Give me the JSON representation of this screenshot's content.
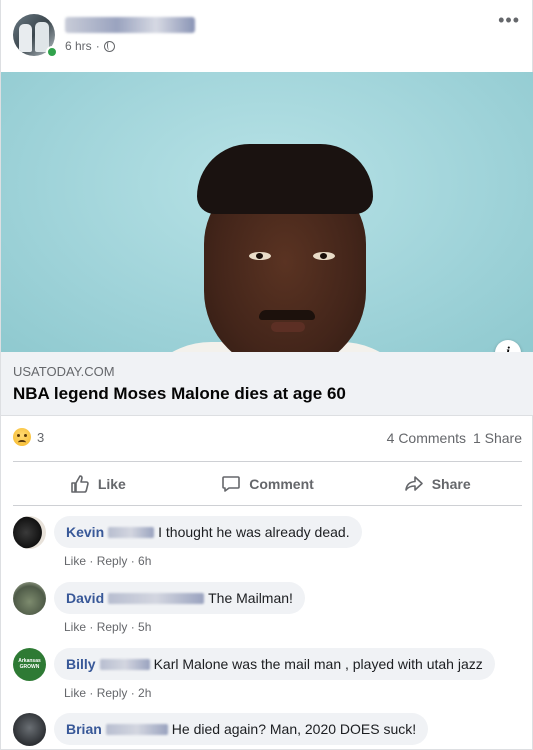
{
  "post": {
    "time": "6 hrs",
    "separator": "·",
    "more_label": "•••"
  },
  "link": {
    "domain": "USATODAY.COM",
    "title": "NBA legend Moses Malone dies at age 60",
    "info_label": "i"
  },
  "reactions": {
    "count": "3",
    "comments": "4 Comments",
    "shares": "1 Share"
  },
  "actions": {
    "like": "Like",
    "comment": "Comment",
    "share": "Share"
  },
  "comments": [
    {
      "name": "Kevin",
      "text": "I thought he was already dead.",
      "like": "Like",
      "reply": "Reply",
      "time": "6h"
    },
    {
      "name": "David",
      "text": "The Mailman!",
      "like": "Like",
      "reply": "Reply",
      "time": "5h"
    },
    {
      "name": "Billy",
      "text": "Karl Malone was the mail man , played with utah jazz",
      "like": "Like",
      "reply": "Reply",
      "time": "2h",
      "avatar_text": "Arkansas GROWN"
    },
    {
      "name": "Brian",
      "text": "He died again? Man, 2020 DOES suck!"
    }
  ],
  "colors": {
    "link_blue": "#385898",
    "secondary": "#65676b",
    "bubble": "#f0f2f5"
  }
}
